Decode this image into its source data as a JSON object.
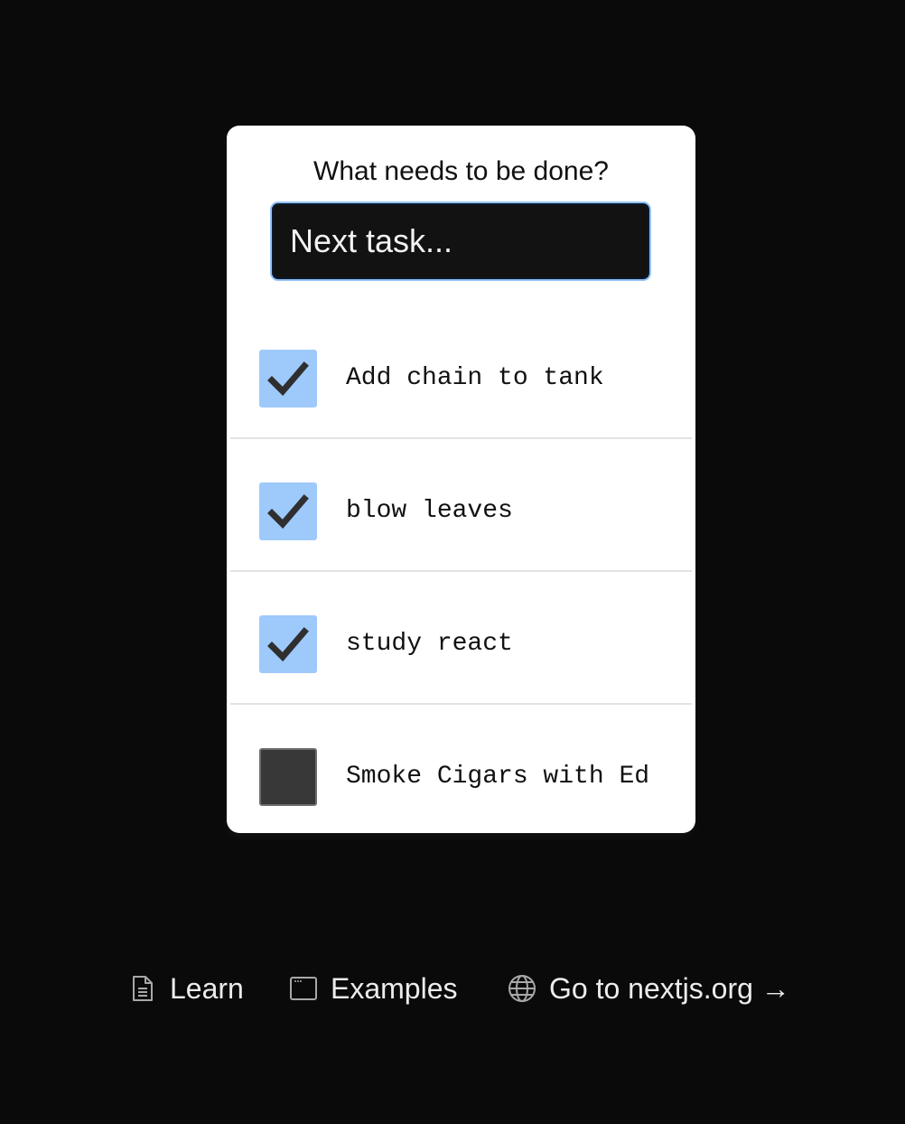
{
  "todo": {
    "prompt": "What needs to be done?",
    "input_placeholder": "Next task...",
    "input_value": "",
    "items": [
      {
        "text": "Add chain to tank",
        "completed": true
      },
      {
        "text": "blow leaves",
        "completed": true
      },
      {
        "text": "study react",
        "completed": true
      },
      {
        "text": "Smoke Cigars with Ed",
        "completed": false
      }
    ],
    "checkbox_checked_color": "#9ec9fb",
    "checkbox_unchecked_color": "#383838"
  },
  "footer": {
    "links": [
      {
        "label": "Learn",
        "icon": "document-icon"
      },
      {
        "label": "Examples",
        "icon": "window-icon"
      },
      {
        "label": "Go to nextjs.org →",
        "icon": "globe-icon"
      }
    ]
  },
  "colors": {
    "background": "#0a0a0a",
    "card": "#ffffff",
    "input_bg": "#121212",
    "focus_ring": "#93c2f5"
  }
}
